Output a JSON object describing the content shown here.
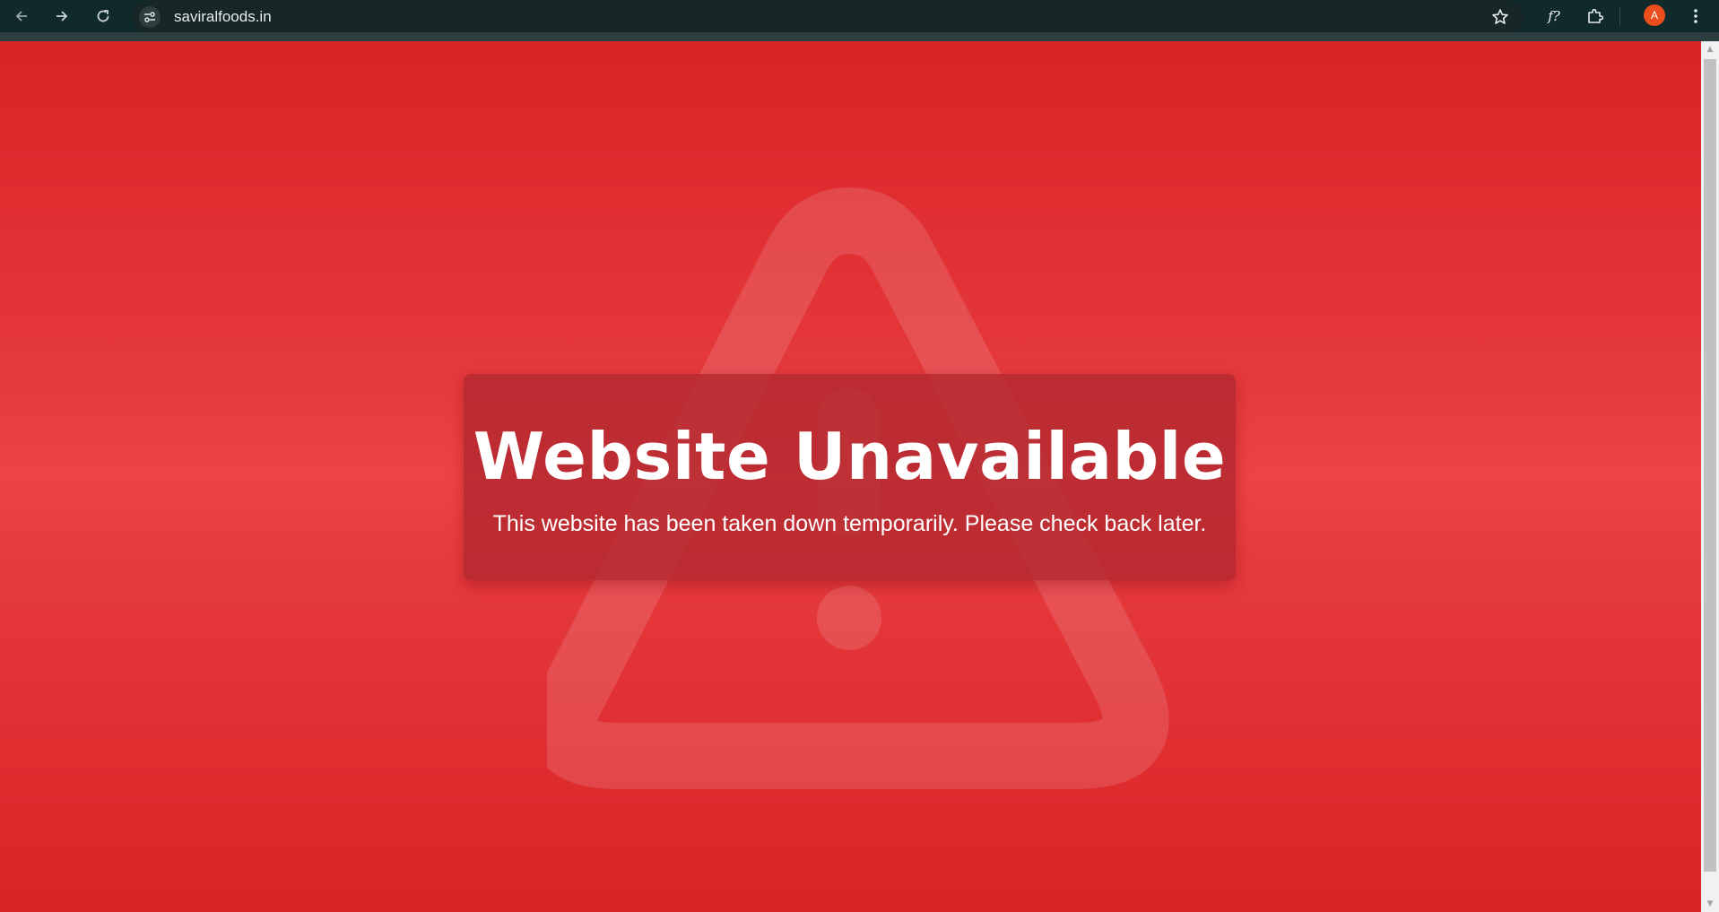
{
  "browser": {
    "url": "saviralfoods.in",
    "profile_initial": "A",
    "extension_label": "f?",
    "icons": {
      "back": "arrow-left-icon",
      "forward": "arrow-right-icon",
      "reload": "reload-icon",
      "site_info": "tune-icon",
      "bookmark": "star-icon",
      "extensions": "puzzle-icon",
      "menu": "kebab-icon"
    },
    "colors": {
      "toolbar": "#10292a",
      "avatar": "#ea4e1c"
    }
  },
  "page": {
    "title": "Website Unavailable",
    "message": "This website has been taken down temporarily. Please check back later.",
    "background_icon": "warning-triangle-icon",
    "colors": {
      "background": "#e63a3d",
      "box": "#b2282e",
      "text": "#ffffff"
    }
  }
}
